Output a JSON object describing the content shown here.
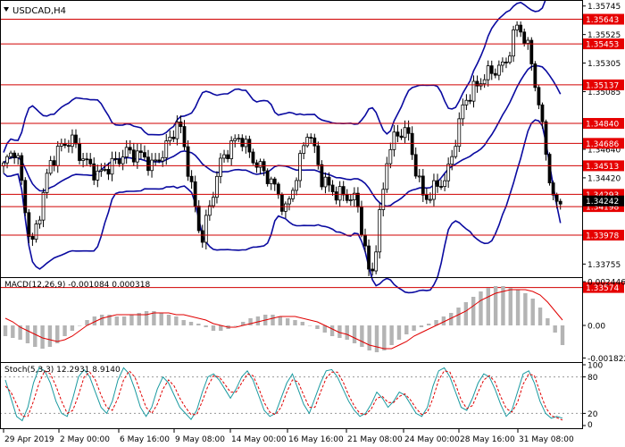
{
  "header": {
    "symbol_label": "USDCAD,H4"
  },
  "colors": {
    "candle": "#000000",
    "bands": "#0a0aa0",
    "level_line": "#d00000",
    "level_tag": "#e60000",
    "current_tag": "#000000",
    "macd_hist": "#b4b4b4",
    "macd_signal": "#e00000",
    "stoch_main": "#1a9aa0",
    "stoch_signal": "#e00000",
    "separator": "#000000",
    "grid_dots": "#999999"
  },
  "chart_data": [
    {
      "type": "candlestick",
      "panel": "main",
      "title": "USDCAD,H4",
      "price_axis_ticks": [
        "1.35745",
        "1.35525",
        "1.35305",
        "1.35085",
        "1.34860",
        "1.34640",
        "1.34420",
        "1.34200",
        "1.33975",
        "1.33755"
      ],
      "price_range": [
        1.3353,
        1.3575
      ],
      "support_resistance_levels": [
        "1.35643",
        "1.35453",
        "1.35137",
        "1.34840",
        "1.34686",
        "1.34513",
        "1.34293",
        "1.34198",
        "1.33978",
        "1.33574"
      ],
      "current_price": "1.34242",
      "indicator": "Bollinger Bands",
      "x_ticks": [
        "29 Apr 2019",
        "2 May 00:00",
        "6 May 16:00",
        "9 May 08:00",
        "14 May 00:00",
        "16 May 16:00",
        "21 May 08:00",
        "24 May 00:00",
        "28 May 16:00",
        "31 May 08:00"
      ]
    },
    {
      "type": "bar",
      "panel": "macd",
      "title": "MACD(12,26,9) -0.001084 0.000318",
      "axis_ticks": [
        "0.002446",
        "0.00",
        "-0.001822"
      ],
      "value_range": [
        -0.002,
        0.0026
      ],
      "histogram": [
        -0.0006,
        -0.0007,
        -0.0008,
        -0.001,
        -0.0012,
        -0.0013,
        -0.0012,
        -0.001,
        -0.0006,
        -0.0003,
        0.0,
        0.0003,
        0.0005,
        0.0006,
        0.0006,
        0.0005,
        0.0005,
        0.0006,
        0.0007,
        0.0008,
        0.0008,
        0.0007,
        0.0006,
        0.0005,
        0.0003,
        0.0002,
        0.0001,
        -0.0001,
        -0.0003,
        -0.0003,
        -0.0002,
        0.0,
        0.0002,
        0.0004,
        0.0005,
        0.0006,
        0.0006,
        0.0005,
        0.0004,
        0.0003,
        0.0002,
        0.0,
        -0.0002,
        -0.0004,
        -0.0006,
        -0.0007,
        -0.0008,
        -0.001,
        -0.0012,
        -0.0014,
        -0.0015,
        -0.0014,
        -0.0011,
        -0.0008,
        -0.0005,
        -0.0003,
        -0.0001,
        0.0001,
        0.0003,
        0.0005,
        0.0007,
        0.001,
        0.0013,
        0.0016,
        0.0019,
        0.0021,
        0.0022,
        0.0022,
        0.0021,
        0.002,
        0.0018,
        0.0015,
        0.001,
        0.0004,
        -0.0004,
        -0.0011
      ],
      "signal": [
        0.0004,
        0.0002,
        -0.0001,
        -0.0003,
        -0.0005,
        -0.0007,
        -0.0008,
        -0.0009,
        -0.0008,
        -0.0006,
        -0.0003,
        0.0,
        0.0002,
        0.0004,
        0.0005,
        0.0006,
        0.0006,
        0.0006,
        0.0006,
        0.0006,
        0.0007,
        0.0007,
        0.0007,
        0.0006,
        0.0006,
        0.0005,
        0.0004,
        0.0003,
        0.0001,
        0.0,
        -0.0001,
        -0.0001,
        0.0,
        0.0001,
        0.0002,
        0.0003,
        0.0004,
        0.0005,
        0.0005,
        0.0005,
        0.0004,
        0.0003,
        0.0002,
        0.0,
        -0.0002,
        -0.0004,
        -0.0005,
        -0.0007,
        -0.0009,
        -0.0011,
        -0.0012,
        -0.0013,
        -0.0013,
        -0.0011,
        -0.0009,
        -0.0006,
        -0.0004,
        -0.0002,
        0.0,
        0.0002,
        0.0004,
        0.0006,
        0.0008,
        0.0011,
        0.0014,
        0.0016,
        0.0018,
        0.0019,
        0.002,
        0.002,
        0.002,
        0.0019,
        0.0017,
        0.0013,
        0.0008,
        0.0003
      ]
    },
    {
      "type": "line",
      "panel": "stochastic",
      "title": "Stoch(5,3,3) 12.2931 8.9140",
      "axis_ticks": [
        "100",
        "80",
        "20",
        "0"
      ],
      "value_range": [
        0,
        100
      ],
      "main": [
        75,
        45,
        15,
        8,
        30,
        70,
        95,
        90,
        70,
        40,
        20,
        15,
        45,
        80,
        92,
        80,
        55,
        30,
        20,
        40,
        75,
        95,
        85,
        60,
        30,
        15,
        30,
        60,
        80,
        70,
        50,
        30,
        20,
        10,
        25,
        55,
        80,
        85,
        75,
        60,
        45,
        60,
        80,
        90,
        75,
        50,
        25,
        15,
        20,
        45,
        70,
        85,
        60,
        35,
        20,
        45,
        70,
        90,
        92,
        80,
        60,
        40,
        25,
        15,
        20,
        35,
        55,
        45,
        30,
        40,
        55,
        50,
        35,
        20,
        15,
        30,
        65,
        90,
        95,
        80,
        55,
        30,
        25,
        45,
        70,
        85,
        80,
        60,
        35,
        15,
        25,
        55,
        85,
        90,
        70,
        40,
        20,
        12,
        15,
        12
      ],
      "signal": [
        65,
        55,
        35,
        15,
        15,
        40,
        70,
        90,
        85,
        65,
        40,
        20,
        25,
        50,
        80,
        88,
        75,
        50,
        30,
        25,
        45,
        75,
        90,
        80,
        55,
        30,
        20,
        35,
        60,
        75,
        65,
        45,
        30,
        18,
        18,
        40,
        65,
        82,
        80,
        68,
        55,
        55,
        70,
        85,
        82,
        62,
        38,
        22,
        18,
        30,
        55,
        75,
        72,
        50,
        30,
        30,
        55,
        78,
        88,
        88,
        72,
        50,
        32,
        20,
        18,
        27,
        45,
        48,
        38,
        38,
        48,
        52,
        42,
        28,
        18,
        22,
        45,
        75,
        90,
        88,
        68,
        42,
        28,
        33,
        55,
        75,
        82,
        72,
        48,
        28,
        22,
        38,
        68,
        85,
        82,
        55,
        30,
        16,
        13,
        9
      ]
    }
  ]
}
